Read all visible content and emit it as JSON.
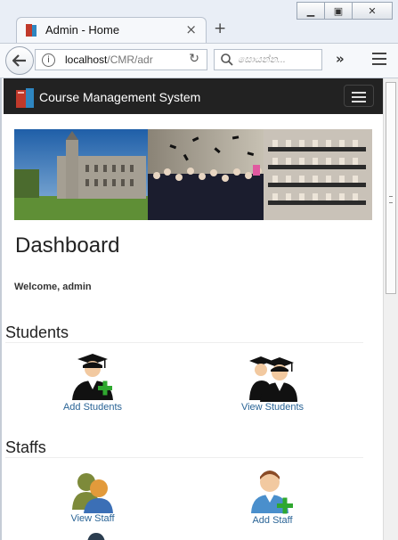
{
  "browser": {
    "tab_title": "Admin - Home",
    "tab_close": "×",
    "new_tab": "+",
    "url_host": "localhost",
    "url_path": "/CMR/adr",
    "search_placeholder": "සොයන්න...",
    "overflow": "»",
    "window_buttons": [
      "minimize",
      "restore",
      "close"
    ]
  },
  "app": {
    "brand": "Course Management System"
  },
  "page": {
    "title": "Dashboard",
    "welcome": "Welcome, admin"
  },
  "sections": [
    {
      "title": "Students",
      "tiles": [
        {
          "label": "Add Students",
          "icon": "graduate-add-icon"
        },
        {
          "label": "View Students",
          "icon": "graduates-group-icon"
        }
      ]
    },
    {
      "title": "Staffs",
      "tiles": [
        {
          "label": "View Staff",
          "icon": "staff-group-icon"
        },
        {
          "label": "Add Staff",
          "icon": "staff-add-icon"
        }
      ]
    }
  ],
  "colors": {
    "appbar": "#222222",
    "link": "#2a6496",
    "add_badge": "#2fa82f"
  }
}
